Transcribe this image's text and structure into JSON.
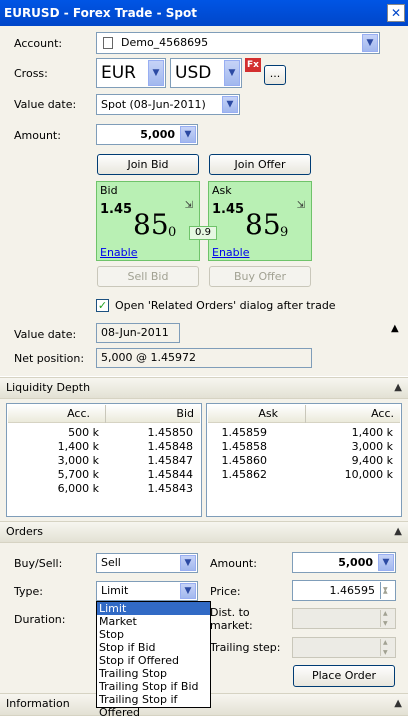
{
  "window": {
    "title": "EURUSD - Forex Trade - Spot",
    "close_glyph": "✕"
  },
  "form": {
    "account_label": "Account:",
    "account_value": "Demo_4568695",
    "cross_label": "Cross:",
    "cross_base": "EUR",
    "cross_quote": "USD",
    "fx_badge": "Fx",
    "more_button": "...",
    "value_date_label": "Value date:",
    "value_date_value": "Spot (08-Jun-2011)",
    "amount_label": "Amount:",
    "amount_value": "5,000",
    "join_bid": "Join Bid",
    "join_offer": "Join Offer"
  },
  "quotes": {
    "bid": {
      "label": "Bid",
      "big_figure": "1.45",
      "pips": "85",
      "fraction": "0",
      "enable": "Enable"
    },
    "ask": {
      "label": "Ask",
      "big_figure": "1.45",
      "pips": "85",
      "fraction": "9",
      "enable": "Enable"
    },
    "spread": "0.9",
    "sell_bid": "Sell Bid",
    "buy_offer": "Buy Offer"
  },
  "options": {
    "open_related_label": "Open 'Related Orders' dialog after trade",
    "open_related_checked": true
  },
  "summary": {
    "value_date_label": "Value date:",
    "value_date_value": "08-Jun-2011",
    "net_position_label": "Net position:",
    "net_position_value": "5,000 @ 1.45972"
  },
  "liquidity": {
    "title": "Liquidity Depth",
    "bid_headers": [
      "Acc.",
      "Bid"
    ],
    "ask_headers": [
      "Ask",
      "Acc."
    ],
    "bid_rows": [
      [
        "500 k",
        "1.45850"
      ],
      [
        "1,400 k",
        "1.45848"
      ],
      [
        "3,000 k",
        "1.45847"
      ],
      [
        "5,700 k",
        "1.45844"
      ],
      [
        "6,000 k",
        "1.45843"
      ]
    ],
    "ask_rows": [
      [
        "1.45859",
        "1,400 k"
      ],
      [
        "1.45858",
        "3,000 k"
      ],
      [
        "1.45860",
        "9,400 k"
      ],
      [
        "1.45862",
        "10,000 k"
      ]
    ]
  },
  "orders": {
    "title": "Orders",
    "buysell_label": "Buy/Sell:",
    "buysell_value": "Sell",
    "type_label": "Type:",
    "type_value": "Limit",
    "duration_label": "Duration:",
    "amount_label": "Amount:",
    "amount_value": "5,000",
    "price_label": "Price:",
    "price_value": "1.46595",
    "dist_label_1": "Dist. to",
    "dist_label_2": "market:",
    "trailing_label": "Trailing step:",
    "place_order": "Place Order",
    "type_options": [
      "Limit",
      "Market",
      "Stop",
      "Stop if Bid",
      "Stop if Offered",
      "Trailing Stop",
      "Trailing Stop if Bid",
      "Trailing Stop if Offered"
    ],
    "type_selected_index": 0
  },
  "information": {
    "title": "Information"
  },
  "colors": {
    "title_bar": "#0055e5",
    "quote_green": "#b9f0b4",
    "selection": "#316ac5"
  }
}
